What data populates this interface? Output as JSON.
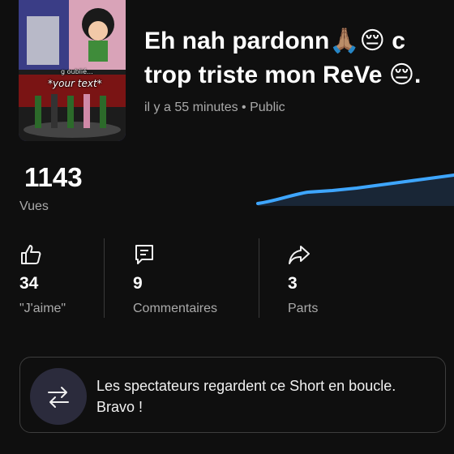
{
  "video": {
    "thumbnail_texts": [
      "g oublié...",
      "*your text*"
    ],
    "title_line1": "Eh nah pardonn🙏🏽😔 c",
    "title_line2": "trop triste mon ReVe 😔.",
    "meta": "il y a 55 minutes • Public"
  },
  "views": {
    "count": "1143",
    "label": "Vues"
  },
  "stats": [
    {
      "icon": "thumbs-up-icon",
      "value": "34",
      "label": "\"J'aime\""
    },
    {
      "icon": "comment-icon",
      "value": "9",
      "label": "Commentaires"
    },
    {
      "icon": "share-icon",
      "value": "3",
      "label": "Parts"
    }
  ],
  "banner": {
    "icon": "repeat-icon",
    "message": "Les spectateurs regardent ce Short en boucle. Bravo !"
  },
  "colors": {
    "background": "#0f0f0f",
    "accent_line": "#3ea6ff",
    "muted_text": "#aaaaaa"
  }
}
